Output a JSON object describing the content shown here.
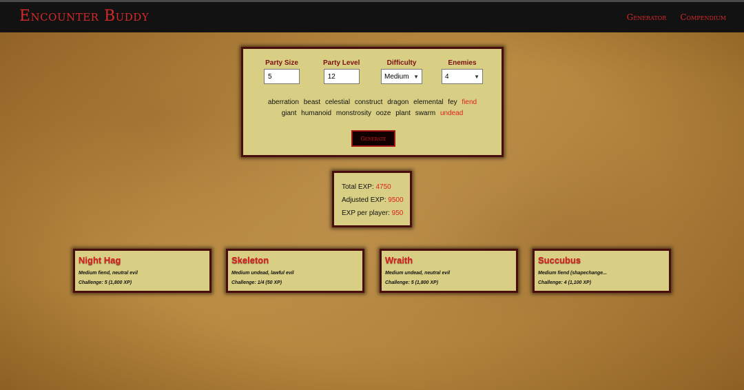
{
  "nav": {
    "brand": "Encounter Buddy",
    "links": [
      "Generator",
      "Compendium"
    ]
  },
  "form": {
    "party_size": {
      "label": "Party Size",
      "value": "5"
    },
    "party_level": {
      "label": "Party Level",
      "value": "12"
    },
    "difficulty": {
      "label": "Difficulty",
      "value": "Medium"
    },
    "enemies": {
      "label": "Enemies",
      "value": "4"
    },
    "types_row1": [
      {
        "label": "aberration",
        "active": false
      },
      {
        "label": "beast",
        "active": false
      },
      {
        "label": "celestial",
        "active": false
      },
      {
        "label": "construct",
        "active": false
      },
      {
        "label": "dragon",
        "active": false
      },
      {
        "label": "elemental",
        "active": false
      },
      {
        "label": "fey",
        "active": false
      },
      {
        "label": "fiend",
        "active": true
      }
    ],
    "types_row2": [
      {
        "label": "giant",
        "active": false
      },
      {
        "label": "humanoid",
        "active": false
      },
      {
        "label": "monstrosity",
        "active": false
      },
      {
        "label": "ooze",
        "active": false
      },
      {
        "label": "plant",
        "active": false
      },
      {
        "label": "swarm",
        "active": false
      },
      {
        "label": "undead",
        "active": true
      }
    ],
    "generate_label": "Generate"
  },
  "exp": {
    "total_label": "Total EXP:",
    "total_value": "4750",
    "adjusted_label": "Adjusted EXP:",
    "adjusted_value": "9500",
    "per_player_label": "EXP per player:",
    "per_player_value": "950"
  },
  "monsters": [
    {
      "name": "Night Hag",
      "meta": "Medium fiend, neutral evil",
      "challenge": "Challenge: 5 (1,800 XP)"
    },
    {
      "name": "Skeleton",
      "meta": "Medium undead, lawful evil",
      "challenge": "Challenge: 1/4 (50 XP)"
    },
    {
      "name": "Wraith",
      "meta": "Medium undead, neutral evil",
      "challenge": "Challenge: 5 (1,800 XP)"
    },
    {
      "name": "Succubus",
      "meta": "Medium fiend (shapechange...",
      "challenge": "Challenge: 4 (1,100 XP)"
    }
  ],
  "colors": {
    "accent": "#d42a2a",
    "panel": "#d8cf84",
    "border": "#4a0d0d",
    "nav": "#121212"
  }
}
